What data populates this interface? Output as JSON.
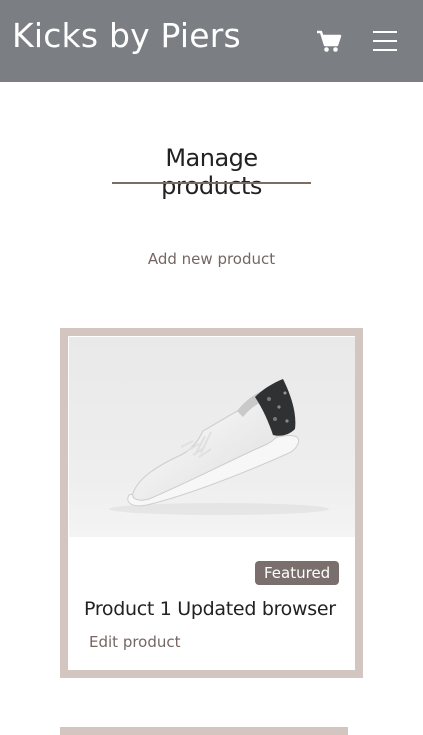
{
  "header": {
    "brand": "Kicks by Piers",
    "cart_icon": "shopping-cart-icon",
    "menu_icon": "hamburger-menu-icon",
    "background_color": "#7b7e83"
  },
  "main": {
    "title": "Manage products",
    "add_link": "Add new product",
    "products": [
      {
        "name": "Product 1 Updated browser",
        "badge": "Featured",
        "edit_label": "Edit product"
      }
    ]
  },
  "colors": {
    "accent": "#d3c6c1",
    "badge": "#7a6f6d",
    "link": "#746762"
  }
}
